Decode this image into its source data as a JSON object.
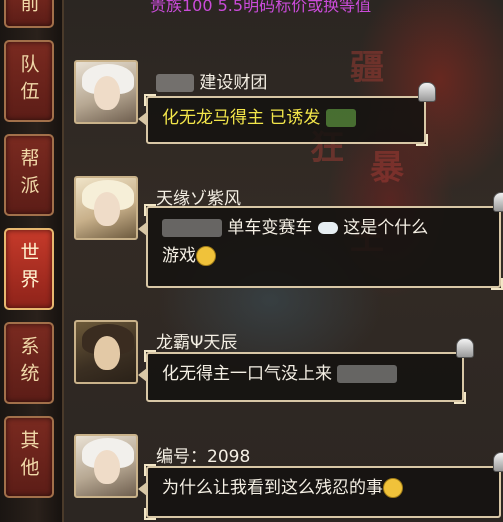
{
  "rail": {
    "tabs": [
      {
        "label": "前",
        "active": false
      },
      {
        "label": "队伍",
        "active": false
      },
      {
        "label": "帮派",
        "active": false
      },
      {
        "label": "世界",
        "active": true
      },
      {
        "label": "系统",
        "active": false
      },
      {
        "label": "其他",
        "active": false
      }
    ]
  },
  "notice": "贵族100 5.5明码标价或换等值",
  "messages": [
    {
      "sender": "建设财团",
      "text": "化无龙马得主 已诱发",
      "color": "#f3e64a"
    },
    {
      "sender": "天缘ゾ紫风",
      "text_a": "单车变赛车",
      "text_b": "这是个什么",
      "text_c": "游戏"
    },
    {
      "sender": "龙霸Ψ天辰",
      "text": "化无得主一口气没上来"
    },
    {
      "sender": "编号：2098",
      "text": "为什么让我看到这么残忍的事"
    }
  ],
  "colors": {
    "accent_tab": "#c63a2a",
    "notice": "#c94bd8",
    "highlight_text": "#f3e64a"
  }
}
